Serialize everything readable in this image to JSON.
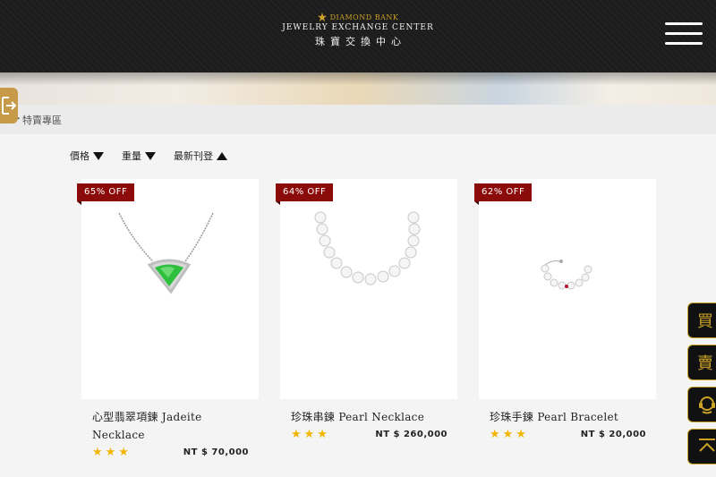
{
  "header": {
    "brand_top": "DIAMOND BANK",
    "brand_main": "JEWELRY EXCHANGE CENTER",
    "brand_zh": "珠寶交換中心"
  },
  "breadcrumb": {
    "separator": ">",
    "current": "特賣專區"
  },
  "sort": [
    {
      "label": "價格",
      "direction": "down"
    },
    {
      "label": "重量",
      "direction": "down"
    },
    {
      "label": "最新刊登",
      "direction": "up"
    }
  ],
  "products": [
    {
      "badge": "65% OFF",
      "title": "心型翡翠項鍊 Jadeite Necklace",
      "stars": "★★★",
      "price": "NT $ 70,000"
    },
    {
      "badge": "64% OFF",
      "title": "珍珠串鍊 Pearl Necklace",
      "stars": "★★★",
      "price": "NT $ 260,000"
    },
    {
      "badge": "62% OFF",
      "title": "珍珠手鍊 Pearl Bracelet",
      "stars": "★★★",
      "price": "NT $ 20,000"
    }
  ],
  "side": {
    "buy": "買",
    "sell": "賣"
  },
  "colors": {
    "header_bg": "#1c1c1c",
    "gold": "#c9a227",
    "badge": "#8b0a0a",
    "star": "#f2b600"
  }
}
